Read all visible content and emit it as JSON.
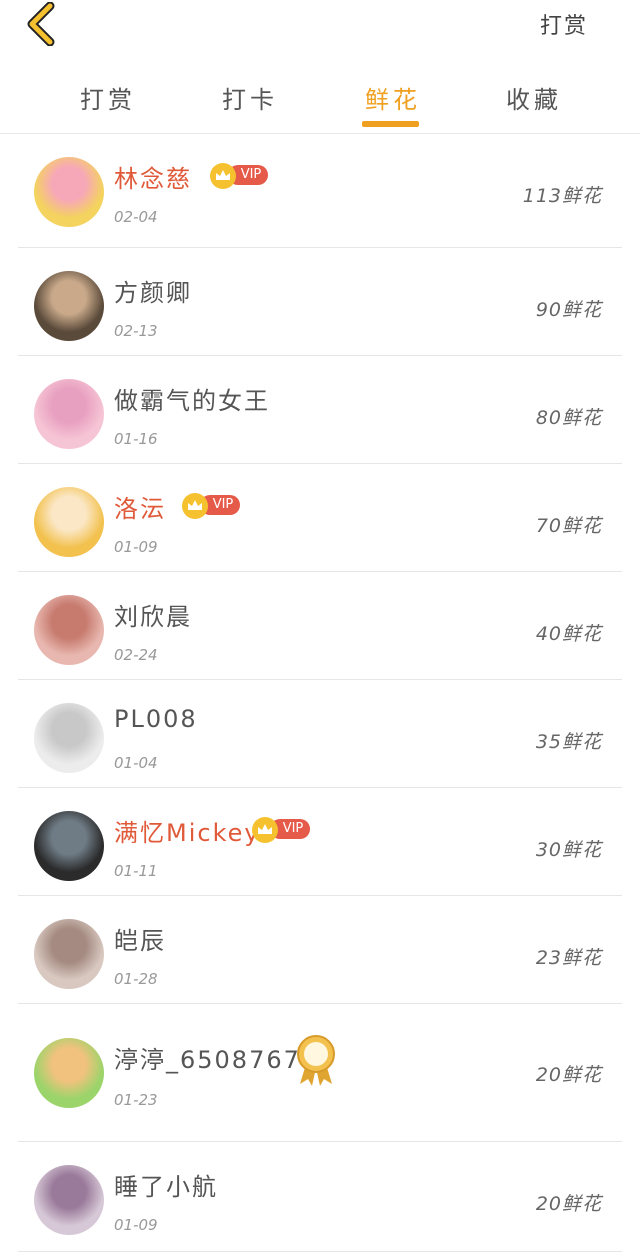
{
  "header": {
    "back_icon": "chevron-left-icon",
    "action_label": "打赏"
  },
  "tabs": [
    {
      "label": "打赏",
      "active": false
    },
    {
      "label": "打卡",
      "active": false
    },
    {
      "label": "鲜花",
      "active": true
    },
    {
      "label": "收藏",
      "active": false
    }
  ],
  "colors": {
    "accent": "#f0a020",
    "vip_name": "#e05a3a",
    "vip_badge": "#e65a4a",
    "crown": "#f5c12e"
  },
  "vip_label": "VIP",
  "rows": [
    {
      "name": "林念慈",
      "date": "02-04",
      "count": "113鲜花",
      "vip": true
    },
    {
      "name": "方颜卿",
      "date": "02-13",
      "count": "90鲜花",
      "vip": false
    },
    {
      "name": "做霸气的女王",
      "date": "01-16",
      "count": "80鲜花",
      "vip": false
    },
    {
      "name": "洛沄",
      "date": "01-09",
      "count": "70鲜花",
      "vip": true
    },
    {
      "name": "刘欣晨",
      "date": "02-24",
      "count": "40鲜花",
      "vip": false
    },
    {
      "name": "PL008",
      "date": "01-04",
      "count": "35鲜花",
      "vip": false
    },
    {
      "name": "满忆Mickey",
      "date": "01-11",
      "count": "30鲜花",
      "vip": true
    },
    {
      "name": "皑辰",
      "date": "01-28",
      "count": "23鲜花",
      "vip": false
    },
    {
      "name": "渟渟_650876779",
      "date": "01-23",
      "count": "20鲜花",
      "vip": false,
      "medal": true
    },
    {
      "name": "睡了小航",
      "date": "01-09",
      "count": "20鲜花",
      "vip": false
    }
  ]
}
